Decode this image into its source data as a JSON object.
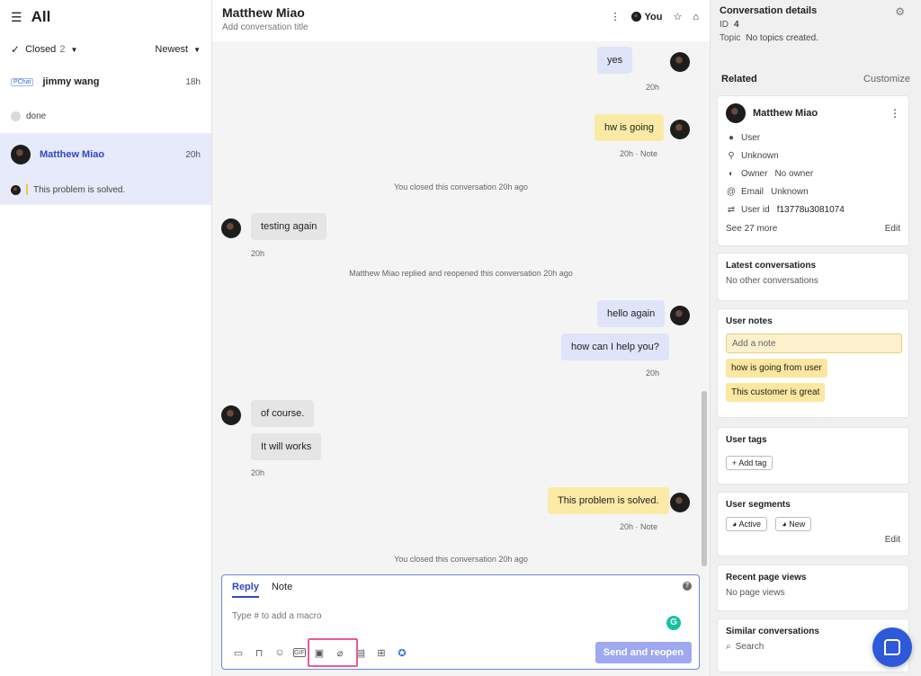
{
  "left": {
    "title": "All",
    "filter": {
      "status": "Closed",
      "count": "2",
      "sort": "Newest"
    },
    "conversations": [
      {
        "name": "jimmy wang",
        "time": "18h",
        "preview": "done",
        "logo": "PChat"
      },
      {
        "name": "Matthew Miao",
        "time": "20h",
        "preview": "This problem is solved."
      }
    ]
  },
  "center": {
    "title": "Matthew Miao",
    "subtitle": "Add conversation title",
    "you_label": "You",
    "messages": [
      {
        "text": "yes",
        "meta": "20h"
      },
      {
        "text": "hw is going",
        "meta": "20h · Note"
      },
      {
        "system": "You closed this conversation 20h ago"
      },
      {
        "text": "testing again",
        "meta": "20h"
      },
      {
        "system": "Matthew Miao replied and reopened this conversation 20h ago"
      },
      {
        "text": "hello again"
      },
      {
        "text": "how can I help you?",
        "meta": "20h"
      },
      {
        "text": "of course."
      },
      {
        "text": "It will works",
        "meta": "20h"
      },
      {
        "text": "This problem is solved.",
        "meta": "20h · Note"
      },
      {
        "system": "You closed this conversation 20h ago"
      }
    ],
    "composer": {
      "tab_reply": "Reply",
      "tab_note": "Note",
      "placeholder": "Type # to add a macro",
      "send_label": "Send and reopen"
    }
  },
  "right": {
    "details_title": "Conversation details",
    "id_label": "ID",
    "id_value": "4",
    "topic_label": "Topic",
    "topic_value": "No topics created.",
    "related_label": "Related",
    "customize_label": "Customize",
    "user_card": {
      "name": "Matthew Miao",
      "role": "User",
      "location": "Unknown",
      "owner_label": "Owner",
      "owner_value": "No owner",
      "email_label": "Email",
      "email_value": "Unknown",
      "userid_label": "User id",
      "userid_value": "f13778u3081074",
      "see_more": "See 27 more",
      "edit": "Edit"
    },
    "latest": {
      "title": "Latest conversations",
      "value": "No other conversations"
    },
    "notes": {
      "title": "User notes",
      "placeholder": "Add a note",
      "items": [
        "how is going from user",
        "This customer is great"
      ]
    },
    "tags": {
      "title": "User tags",
      "add_label": "+ Add tag"
    },
    "segments": {
      "title": "User segments",
      "items": [
        "Active",
        "New"
      ],
      "edit": "Edit"
    },
    "page_views": {
      "title": "Recent page views",
      "value": "No page views"
    },
    "similar": {
      "title": "Similar conversations",
      "search": "Search"
    }
  }
}
